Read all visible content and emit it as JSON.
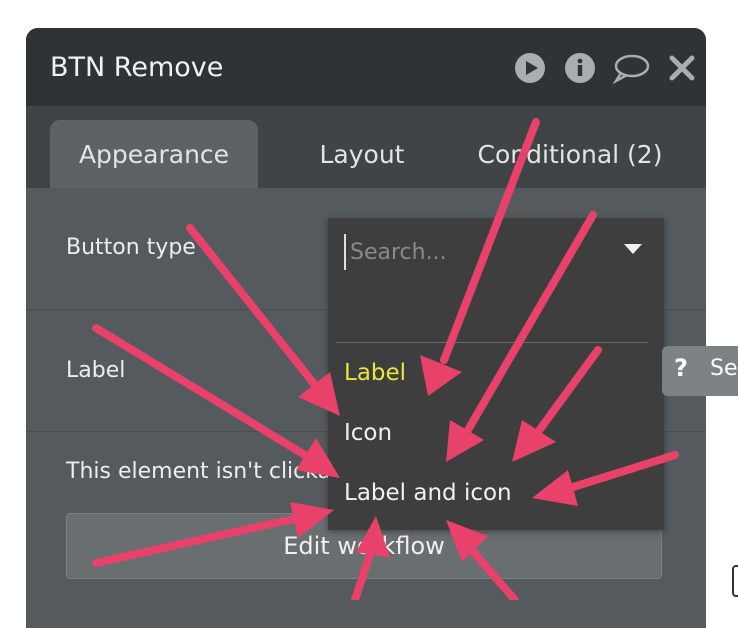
{
  "window": {
    "title": "BTN Remove"
  },
  "header_icons": [
    "play-icon",
    "info-icon",
    "comment-icon",
    "close-icon"
  ],
  "tabs": [
    {
      "label": "Appearance",
      "active": true
    },
    {
      "label": "Layout",
      "active": false
    },
    {
      "label": "Conditional (2)",
      "active": false
    }
  ],
  "fields": {
    "button_type_label": "Button type",
    "label_label": "Label",
    "not_clickable_text": "This element isn't clicka",
    "edit_workflow_label": "Edit workflow"
  },
  "dropdown": {
    "search_placeholder": "Search...",
    "options": [
      "Label",
      "Icon",
      "Label and icon"
    ],
    "selected": "Label"
  },
  "help_tab": {
    "icon": "question-icon",
    "text": "Se"
  },
  "colors": {
    "header_bg": "#2e3336",
    "panel_bg": "#555a5e",
    "dropdown_bg": "#3e3e3e",
    "selected_option": "#e9e63c",
    "arrow": "#e8416a"
  }
}
